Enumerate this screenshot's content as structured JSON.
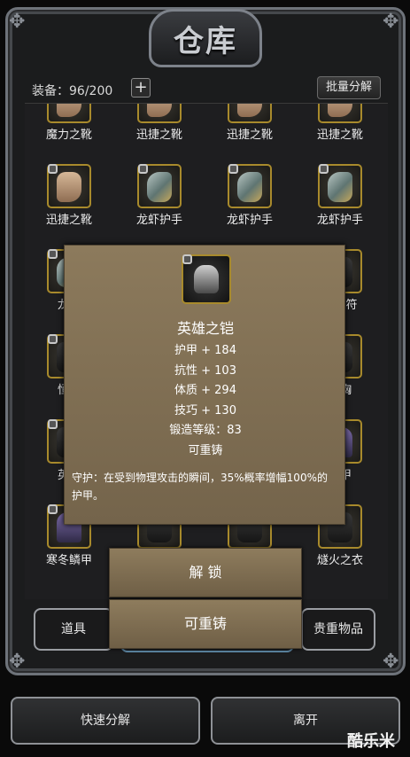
{
  "title": "仓库",
  "equip_count": "装备：96/200",
  "add_slot": "+",
  "batch_button": "批量分解",
  "items": [
    {
      "name": "魔力之靴",
      "kind": "boot",
      "locked": true
    },
    {
      "name": "迅捷之靴",
      "kind": "boot",
      "locked": false
    },
    {
      "name": "迅捷之靴",
      "kind": "boot",
      "locked": false
    },
    {
      "name": "迅捷之靴",
      "kind": "boot",
      "locked": false
    },
    {
      "name": "迅捷之靴",
      "kind": "boot",
      "locked": true
    },
    {
      "name": "龙虾护手",
      "kind": "glove",
      "locked": true
    },
    {
      "name": "龙虾护手",
      "kind": "glove",
      "locked": true
    },
    {
      "name": "龙虾护手",
      "kind": "glove",
      "locked": true
    },
    {
      "name": "龙虾",
      "kind": "glove",
      "locked": true
    },
    {
      "name": "",
      "kind": "dark",
      "locked": false
    },
    {
      "name": "",
      "kind": "dark",
      "locked": false
    },
    {
      "name": "化护符",
      "kind": "dark",
      "locked": false
    },
    {
      "name": "恒金",
      "kind": "dark",
      "locked": true
    },
    {
      "name": "",
      "kind": "dark",
      "locked": false
    },
    {
      "name": "",
      "kind": "dark",
      "locked": false
    },
    {
      "name": "护胸",
      "kind": "dark",
      "locked": false
    },
    {
      "name": "英雄",
      "kind": "dark",
      "locked": true
    },
    {
      "name": "",
      "kind": "dark",
      "locked": false
    },
    {
      "name": "",
      "kind": "dark",
      "locked": false
    },
    {
      "name": "鳞甲",
      "kind": "armor",
      "locked": false
    },
    {
      "name": "寒冬鳞甲",
      "kind": "armor",
      "locked": true
    },
    {
      "name": "",
      "kind": "dark",
      "locked": false
    },
    {
      "name": "",
      "kind": "dark",
      "locked": false
    },
    {
      "name": "燧火之衣",
      "kind": "dark",
      "locked": false
    }
  ],
  "popup": {
    "item_name": "英雄之铠",
    "stats": [
      "护甲 + 184",
      "抗性 + 103",
      "体质 + 294",
      "技巧 + 130",
      "锻造等级：83",
      "可重铸"
    ],
    "description": "守护：在受到物理攻击的瞬间，35%概率增幅100%的护甲。",
    "unlock_button": "解 锁",
    "recast_button": "可重铸"
  },
  "tabs": {
    "left": "道具",
    "right": "贵重物品"
  },
  "bottom": {
    "decompose": "快速分解",
    "leave": "离开"
  },
  "watermark": "酷乐米",
  "colors": {
    "slot_border": "#a88a2c",
    "popup_bg": "#7e6d52",
    "frame": "#6e737a"
  }
}
